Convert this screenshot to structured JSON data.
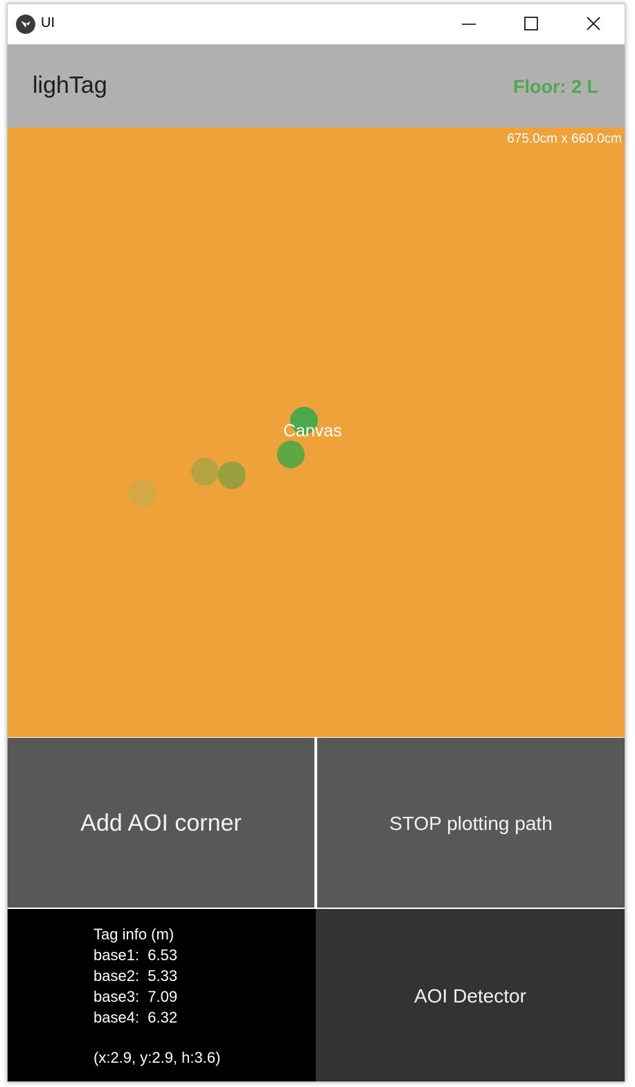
{
  "window": {
    "title": "UI",
    "icons": {
      "app": "kivy-logo-icon",
      "minimize": "minimize-icon",
      "maximize": "maximize-icon",
      "close": "close-icon"
    }
  },
  "header": {
    "app_name": "lighTag",
    "floor_label": "Floor: 2 L",
    "floor_color": "#4fa84f",
    "background": "#b0b0b0"
  },
  "canvas": {
    "size_label": "675.0cm x 660.0cm",
    "label": "Canvas",
    "background": "#f0a23a",
    "path_points": [
      {
        "color": "#d4a843"
      },
      {
        "color": "#b4a340"
      },
      {
        "color": "#98a03e"
      },
      {
        "color": "#5fa645"
      },
      {
        "color": "#4ea74b"
      }
    ]
  },
  "buttons": {
    "add_aoi_corner": "Add AOI corner",
    "stop_plotting": "STOP plotting path",
    "aoi_detector": "AOI Detector"
  },
  "tag_info": {
    "heading": "Tag info (m)",
    "bases": [
      {
        "label": "base1:",
        "value": "6.53"
      },
      {
        "label": "base2:",
        "value": "5.33"
      },
      {
        "label": "base3:",
        "value": "7.09"
      },
      {
        "label": "base4:",
        "value": "6.32"
      }
    ],
    "coords": "(x:2.9, y:2.9, h:3.6)"
  }
}
